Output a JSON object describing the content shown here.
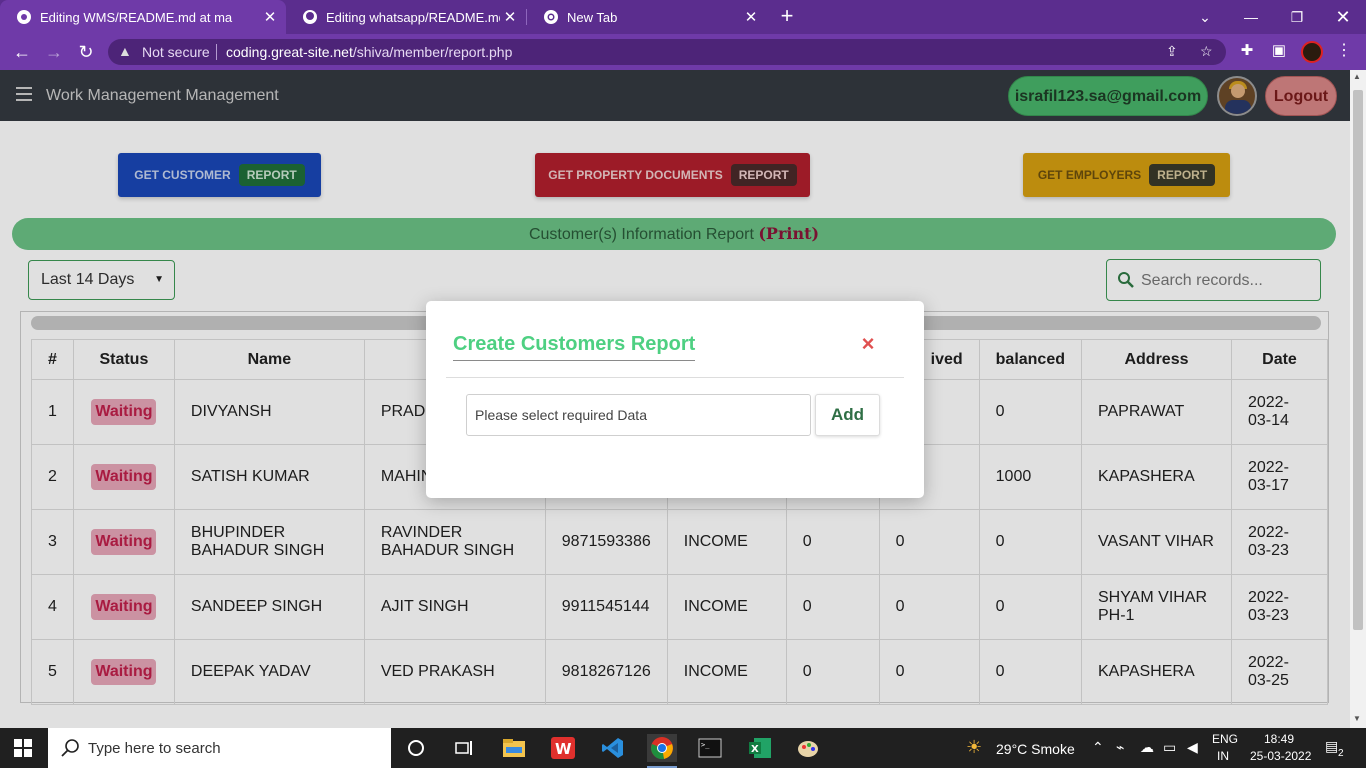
{
  "browser": {
    "tabs": [
      {
        "title": "Editing WMS/README.md at ma",
        "icon": "github-icon"
      },
      {
        "title": "Editing whatsapp/README.md a",
        "icon": "github-icon"
      },
      {
        "title": "New Tab",
        "icon": "chrome-icon"
      }
    ],
    "not_secure": "Not secure",
    "url_host": "coding.great-site.net",
    "url_path": "/shiva/member/report.php"
  },
  "app": {
    "title": "Work Management Management",
    "email": "israfil123.sa@gmail.com",
    "logout": "Logout"
  },
  "report_buttons": [
    {
      "label": "GET CUSTOMER",
      "badge": "REPORT"
    },
    {
      "label": "GET PROPERTY DOCUMENTS",
      "badge": "REPORT"
    },
    {
      "label": "GET EMPLOYERS",
      "badge": "REPORT"
    }
  ],
  "info_bar": {
    "text": "Customer(s) Information Report ",
    "print": "(Print)"
  },
  "filter": {
    "period": "Last 14 Days",
    "search_placeholder": "Search records..."
  },
  "table": {
    "headers": [
      "#",
      "Status",
      "Name",
      "",
      "",
      "",
      "",
      "ived",
      "balanced",
      "Address",
      "Date"
    ],
    "rows": [
      {
        "num": "1",
        "status": "Waiting",
        "name": "DIVYANSH",
        "father": "PRADE",
        "phone": "",
        "type": "",
        "c1": "",
        "c2": "",
        "bal": "0",
        "addr": "PAPRAWAT",
        "date": "2022-03-14"
      },
      {
        "num": "2",
        "status": "Waiting",
        "name": "SATISH KUMAR",
        "father": "MAHIN",
        "phone": "",
        "type": "",
        "c1": "",
        "c2": "",
        "bal": "1000",
        "addr": "KAPASHERA",
        "date": "2022-03-17"
      },
      {
        "num": "3",
        "status": "Waiting",
        "name": "BHUPINDER BAHADUR SINGH",
        "father": "RAVINDER BAHADUR SINGH",
        "phone": "9871593386",
        "type": "INCOME",
        "c1": "0",
        "c2": "0",
        "bal": "0",
        "addr": "VASANT VIHAR",
        "date": "2022-03-23"
      },
      {
        "num": "4",
        "status": "Waiting",
        "name": "SANDEEP SINGH",
        "father": "AJIT SINGH",
        "phone": "9911545144",
        "type": "INCOME",
        "c1": "0",
        "c2": "0",
        "bal": "0",
        "addr": "SHYAM VIHAR PH-1",
        "date": "2022-03-23"
      },
      {
        "num": "5",
        "status": "Waiting",
        "name": "DEEPAK YADAV",
        "father": "VED PRAKASH",
        "phone": "9818267126",
        "type": "INCOME",
        "c1": "0",
        "c2": "0",
        "bal": "0",
        "addr": "KAPASHERA",
        "date": "2022-03-25"
      }
    ]
  },
  "modal": {
    "title": "Create Customers Report",
    "close": "×",
    "input_value": "Please select required Data",
    "add": "Add"
  },
  "taskbar": {
    "search": "Type here to search",
    "weather": "29°C  Smoke",
    "lang_top": "ENG",
    "lang_bottom": "IN",
    "time": "18:49",
    "date": "25-03-2022",
    "notif_count": "2"
  }
}
